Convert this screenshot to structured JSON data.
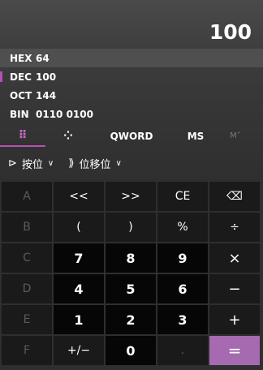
{
  "display": {
    "value": "100"
  },
  "radix": [
    {
      "label": "HEX",
      "value": "64"
    },
    {
      "label": "DEC",
      "value": "100"
    },
    {
      "label": "OCT",
      "value": "144"
    },
    {
      "label": "BIN",
      "value": "0110 0100"
    }
  ],
  "modes": {
    "keypad_icon": "⠿",
    "bitflip_icon": "⁘",
    "word": "QWORD",
    "ms": "MS",
    "mplus": "M˅"
  },
  "ops": {
    "bitwise_label": "按位",
    "bitshift_label": "位移位",
    "bitwise_icon": "⊳",
    "bitshift_icon": "⟫",
    "chevron": "∨"
  },
  "keys": [
    [
      "A",
      "<<",
      ">>",
      "CE",
      "⌫"
    ],
    [
      "B",
      "(",
      ")",
      "%",
      "÷"
    ],
    [
      "C",
      "7",
      "8",
      "9",
      "×"
    ],
    [
      "D",
      "4",
      "5",
      "6",
      "−"
    ],
    [
      "E",
      "1",
      "2",
      "3",
      "+"
    ],
    [
      "F",
      "+/−",
      "0",
      ".",
      "="
    ]
  ],
  "colors": {
    "accent": "#b84fb8",
    "equals": "#a56ab0"
  }
}
